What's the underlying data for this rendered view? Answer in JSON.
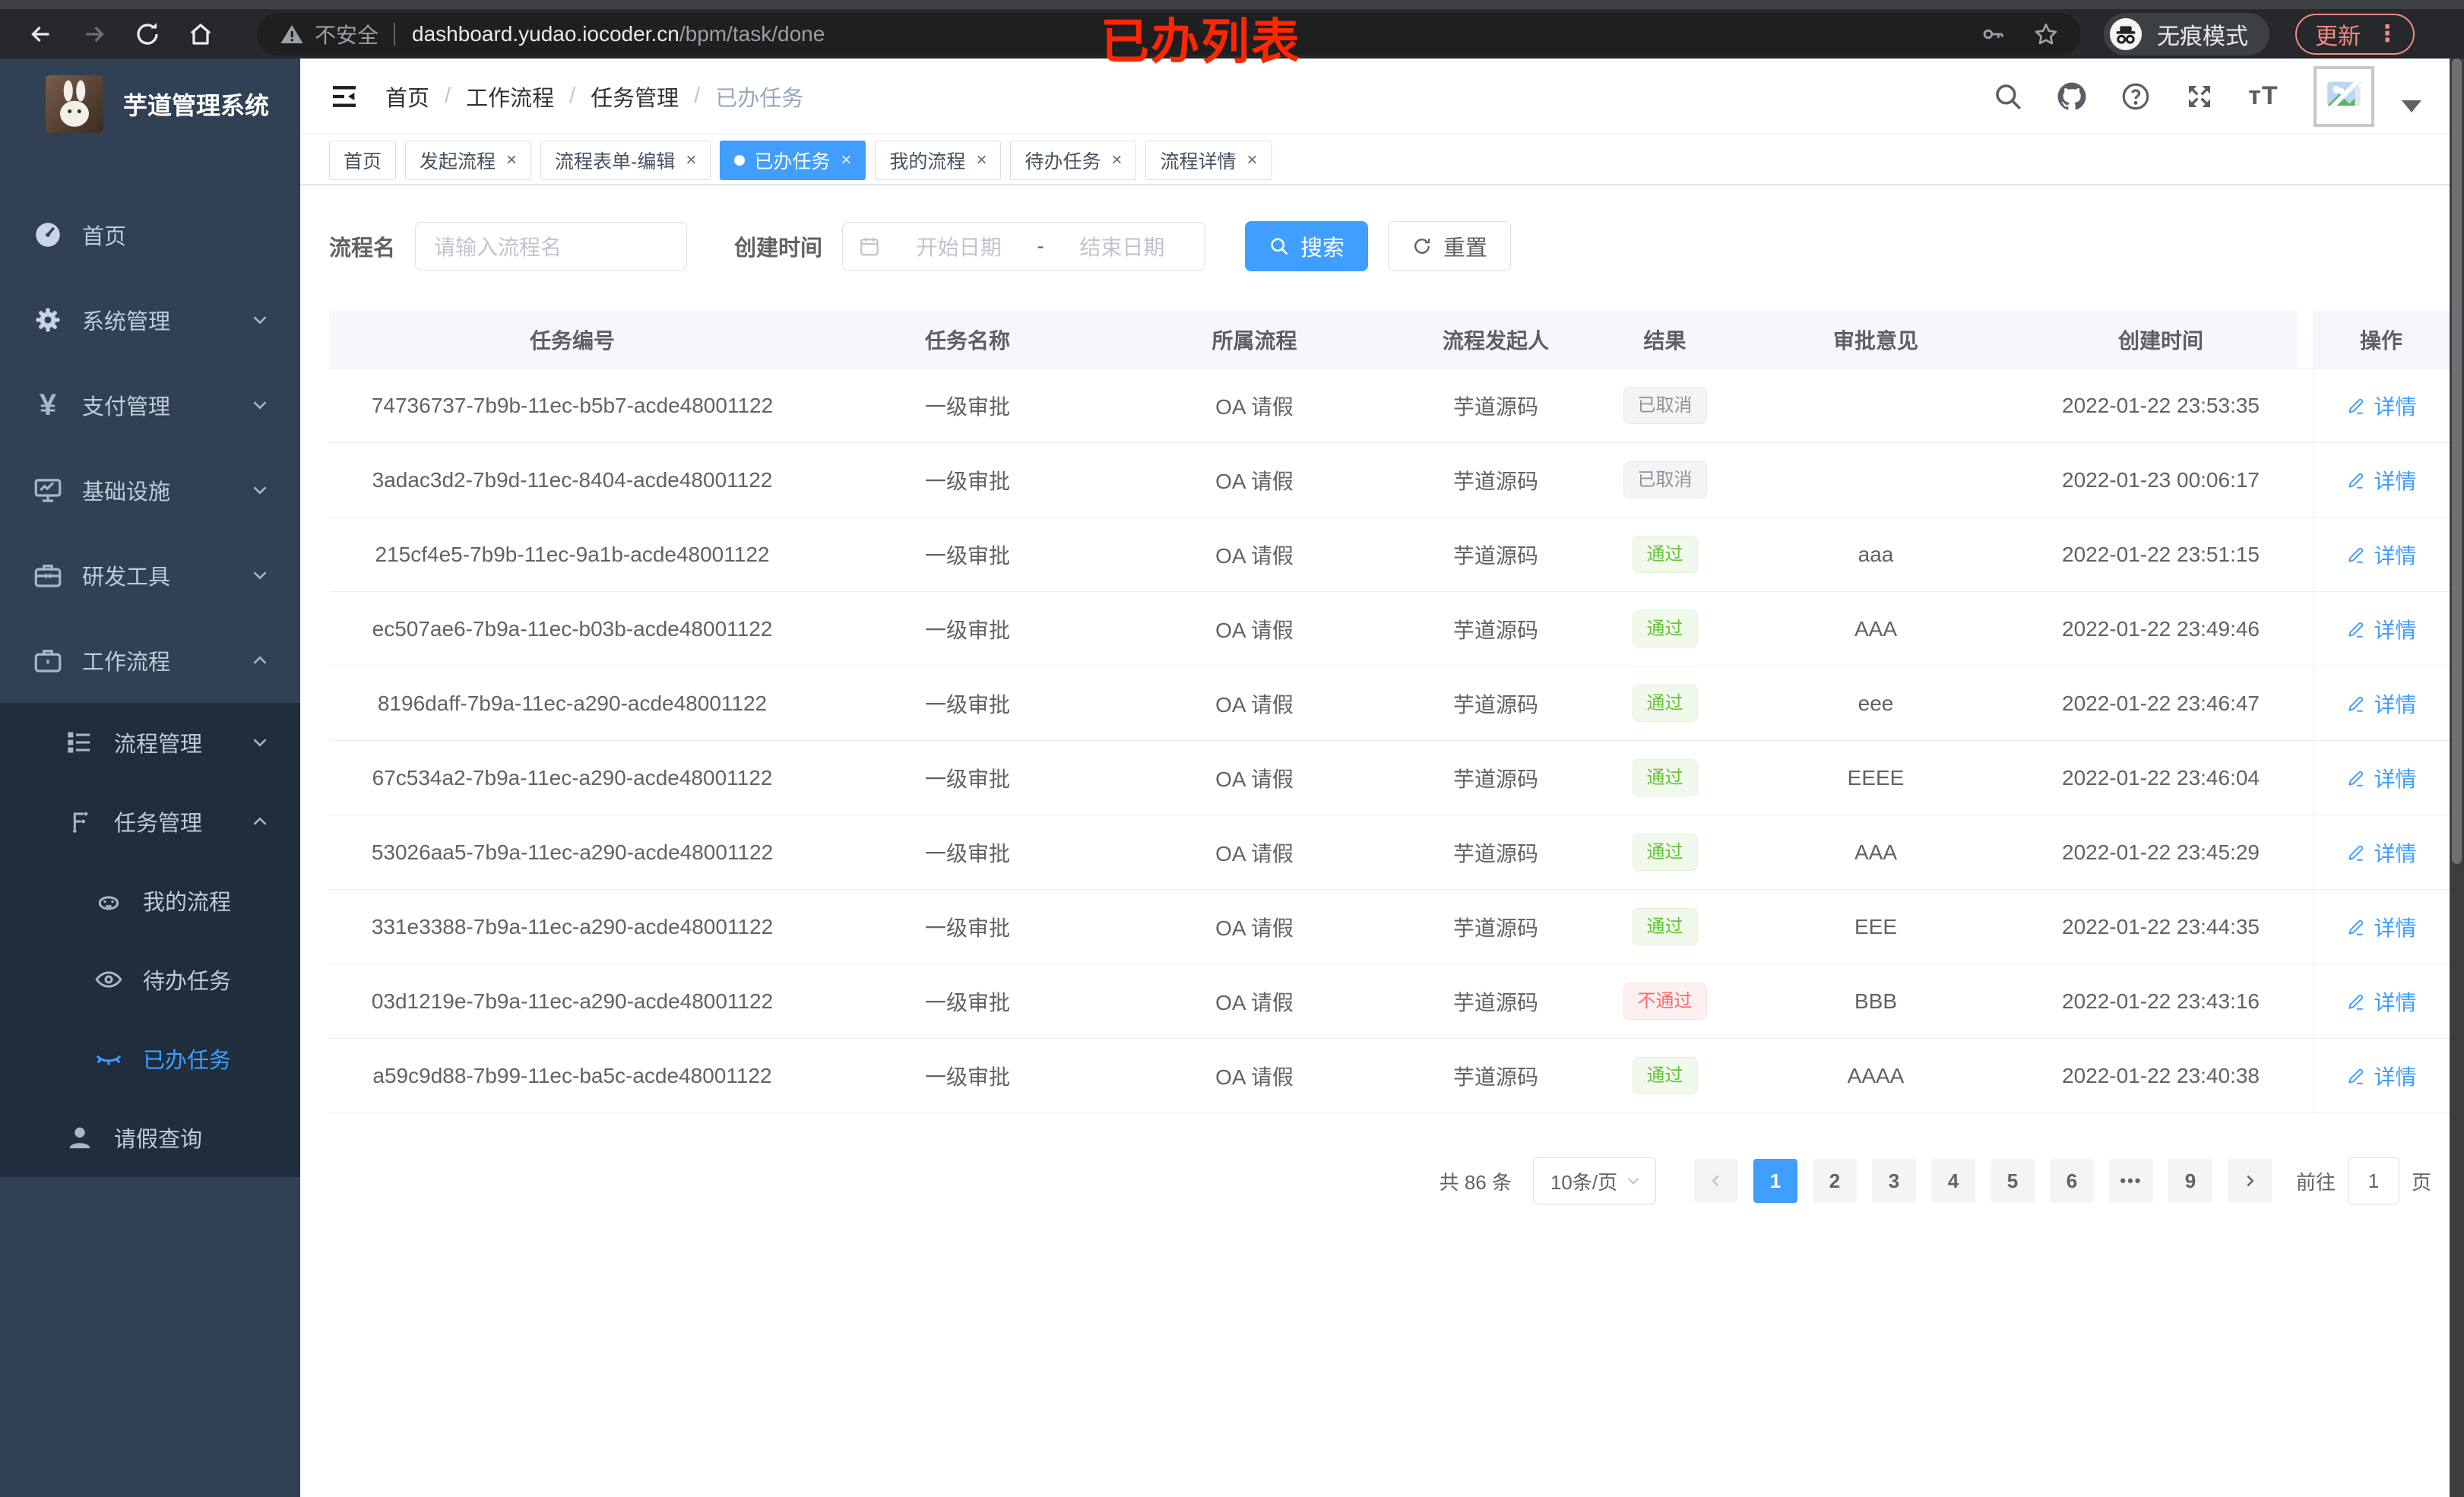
{
  "annotation": {
    "text": "已办列表",
    "color": "#ff2600"
  },
  "browser": {
    "security_label": "不安全",
    "url_host": "dashboard.yudao.iocoder.cn",
    "url_path": "/bpm/task/done",
    "incognito_label": "无痕模式",
    "update_label": "更新"
  },
  "sidebar": {
    "title": "芋道管理系统",
    "items": [
      {
        "label": "首页"
      },
      {
        "label": "系统管理"
      },
      {
        "label": "支付管理"
      },
      {
        "label": "基础设施"
      },
      {
        "label": "研发工具"
      },
      {
        "label": "工作流程"
      },
      {
        "label": "流程管理"
      },
      {
        "label": "任务管理"
      },
      {
        "label": "我的流程"
      },
      {
        "label": "待办任务"
      },
      {
        "label": "已办任务"
      },
      {
        "label": "请假查询"
      }
    ]
  },
  "breadcrumb": [
    "首页",
    "工作流程",
    "任务管理",
    "已办任务"
  ],
  "tabs": [
    {
      "label": "首页",
      "closable": false,
      "active": false
    },
    {
      "label": "发起流程",
      "closable": true,
      "active": false
    },
    {
      "label": "流程表单-编辑",
      "closable": true,
      "active": false
    },
    {
      "label": "已办任务",
      "closable": true,
      "active": true
    },
    {
      "label": "我的流程",
      "closable": true,
      "active": false
    },
    {
      "label": "待办任务",
      "closable": true,
      "active": false
    },
    {
      "label": "流程详情",
      "closable": true,
      "active": false
    }
  ],
  "search": {
    "name_label": "流程名",
    "name_placeholder": "请输入流程名",
    "time_label": "创建时间",
    "start_placeholder": "开始日期",
    "range_separator": "-",
    "end_placeholder": "结束日期",
    "search_button": "搜索",
    "reset_button": "重置"
  },
  "table": {
    "headers": [
      "任务编号",
      "任务名称",
      "所属流程",
      "流程发起人",
      "结果",
      "审批意见",
      "创建时间",
      "操作"
    ],
    "action_label": "详情",
    "rows": [
      {
        "id": "74736737-7b9b-11ec-b5b7-acde48001122",
        "name": "一级审批",
        "process": "OA 请假",
        "starter": "芋道源码",
        "result": "已取消",
        "result_type": "info",
        "opinion": "",
        "created": "2022-01-22 23:53:35"
      },
      {
        "id": "3adac3d2-7b9d-11ec-8404-acde48001122",
        "name": "一级审批",
        "process": "OA 请假",
        "starter": "芋道源码",
        "result": "已取消",
        "result_type": "info",
        "opinion": "",
        "created": "2022-01-23 00:06:17"
      },
      {
        "id": "215cf4e5-7b9b-11ec-9a1b-acde48001122",
        "name": "一级审批",
        "process": "OA 请假",
        "starter": "芋道源码",
        "result": "通过",
        "result_type": "success",
        "opinion": "aaa",
        "created": "2022-01-22 23:51:15"
      },
      {
        "id": "ec507ae6-7b9a-11ec-b03b-acde48001122",
        "name": "一级审批",
        "process": "OA 请假",
        "starter": "芋道源码",
        "result": "通过",
        "result_type": "success",
        "opinion": "AAA",
        "created": "2022-01-22 23:49:46"
      },
      {
        "id": "8196daff-7b9a-11ec-a290-acde48001122",
        "name": "一级审批",
        "process": "OA 请假",
        "starter": "芋道源码",
        "result": "通过",
        "result_type": "success",
        "opinion": "eee",
        "created": "2022-01-22 23:46:47"
      },
      {
        "id": "67c534a2-7b9a-11ec-a290-acde48001122",
        "name": "一级审批",
        "process": "OA 请假",
        "starter": "芋道源码",
        "result": "通过",
        "result_type": "success",
        "opinion": "EEEE",
        "created": "2022-01-22 23:46:04"
      },
      {
        "id": "53026aa5-7b9a-11ec-a290-acde48001122",
        "name": "一级审批",
        "process": "OA 请假",
        "starter": "芋道源码",
        "result": "通过",
        "result_type": "success",
        "opinion": "AAA",
        "created": "2022-01-22 23:45:29"
      },
      {
        "id": "331e3388-7b9a-11ec-a290-acde48001122",
        "name": "一级审批",
        "process": "OA 请假",
        "starter": "芋道源码",
        "result": "通过",
        "result_type": "success",
        "opinion": "EEE",
        "created": "2022-01-22 23:44:35"
      },
      {
        "id": "03d1219e-7b9a-11ec-a290-acde48001122",
        "name": "一级审批",
        "process": "OA 请假",
        "starter": "芋道源码",
        "result": "不通过",
        "result_type": "danger",
        "opinion": "BBB",
        "created": "2022-01-22 23:43:16"
      },
      {
        "id": "a59c9d88-7b99-11ec-ba5c-acde48001122",
        "name": "一级审批",
        "process": "OA 请假",
        "starter": "芋道源码",
        "result": "通过",
        "result_type": "success",
        "opinion": "AAAA",
        "created": "2022-01-22 23:40:38"
      }
    ]
  },
  "pagination": {
    "total_label": "共 86 条",
    "page_size": "10条/页",
    "pages": [
      {
        "label": "1",
        "active": true
      },
      {
        "label": "2"
      },
      {
        "label": "3"
      },
      {
        "label": "4"
      },
      {
        "label": "5"
      },
      {
        "label": "6"
      },
      {
        "label": "•••",
        "ellipsis": true
      },
      {
        "label": "9"
      }
    ],
    "goto_label": "前往",
    "goto_value": "1",
    "goto_suffix": "页"
  },
  "colors": {
    "accent": "#409eff",
    "success": "#67c23a",
    "danger": "#f56c6c",
    "info": "#909399",
    "sidebar": "#304156",
    "submenu": "#1f2d3d"
  }
}
